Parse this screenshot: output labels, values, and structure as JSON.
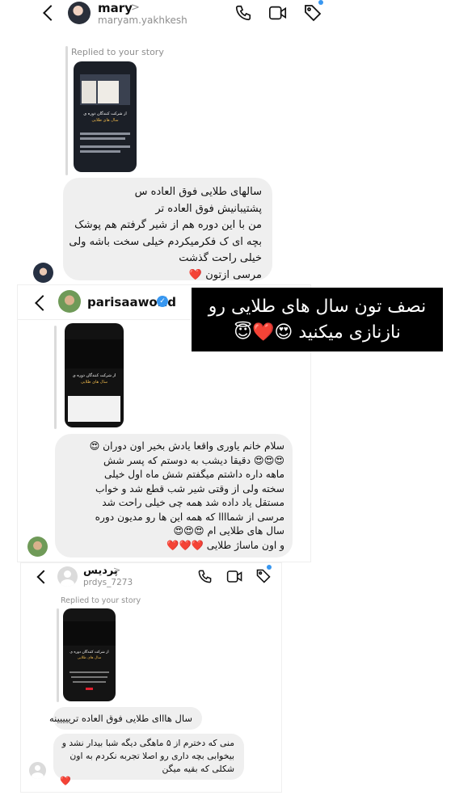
{
  "chat1": {
    "name": "mary",
    "chevron": ">",
    "handle": "maryam.yakhkesh",
    "replied": "Replied to your story",
    "message_lines": [
      "سالهای طلایی فوق العاده س",
      "پشتیبانیش فوق العاده تر",
      "من با این دوره هم از شیر گرفتم هم پوشک",
      "بچه ای ک فکرمیکردم خیلی سخت باشه ولی",
      "خیلی راحت گذشت",
      "مرسی ازتون ❤️"
    ]
  },
  "chat2": {
    "name": "parisaaworld",
    "verified": "✓",
    "message_lines": [
      "سلام خانم یاوری واقعا یادش بخیر اون دوران 😍",
      "😍😍😍 دقیقا دیشب به دوستم که پسر شش",
      "ماهه داره داشتم میگفتم شش ماه اول خیلی",
      "سخته ولی از وقتی شیر شب قطع شد و خواب",
      "مستقل یاد داده شد همه چی خیلی راحت شد",
      "مرسی از شماااا که همه این ها رو مدیون دوره",
      "سال های طلایی ام 😍😍😍",
      "و اون ماساژ طلایی ❤️❤️❤️"
    ]
  },
  "overlay": {
    "line1": "نصف تون سال های طلایی رو",
    "line2": "نازنازی میکنید 😍❤️😇"
  },
  "chat3": {
    "name": "پردیس",
    "chevron": ">",
    "handle": "prdys_7273",
    "replied": "Replied to your story",
    "message1": "سال هااای طلایی فوق العاده ترییییینه",
    "message2_lines": [
      "منی که دخترم از ۵ ماهگی دیگه شبا بیدار نشد و",
      "بیخوابی بچه داری رو اصلا تجربه نکردم به اون",
      "شکلی که بقیه میگن"
    ],
    "reaction": "❤️"
  },
  "story": {
    "title_line1": "از شرکت کنندگان دوره ی",
    "title_line2": "سال های طلایی"
  },
  "colors": {
    "bubble": "#efefef",
    "muted": "#8e8e8e",
    "verified": "#3897f0",
    "overlay_bg": "#000000",
    "heart": "#e0202f",
    "story_title": "#e8b44a"
  },
  "icons": [
    "back-chevron-icon",
    "phone-icon",
    "video-icon",
    "tag-icon",
    "verified-badge-icon",
    "heart-icon"
  ]
}
